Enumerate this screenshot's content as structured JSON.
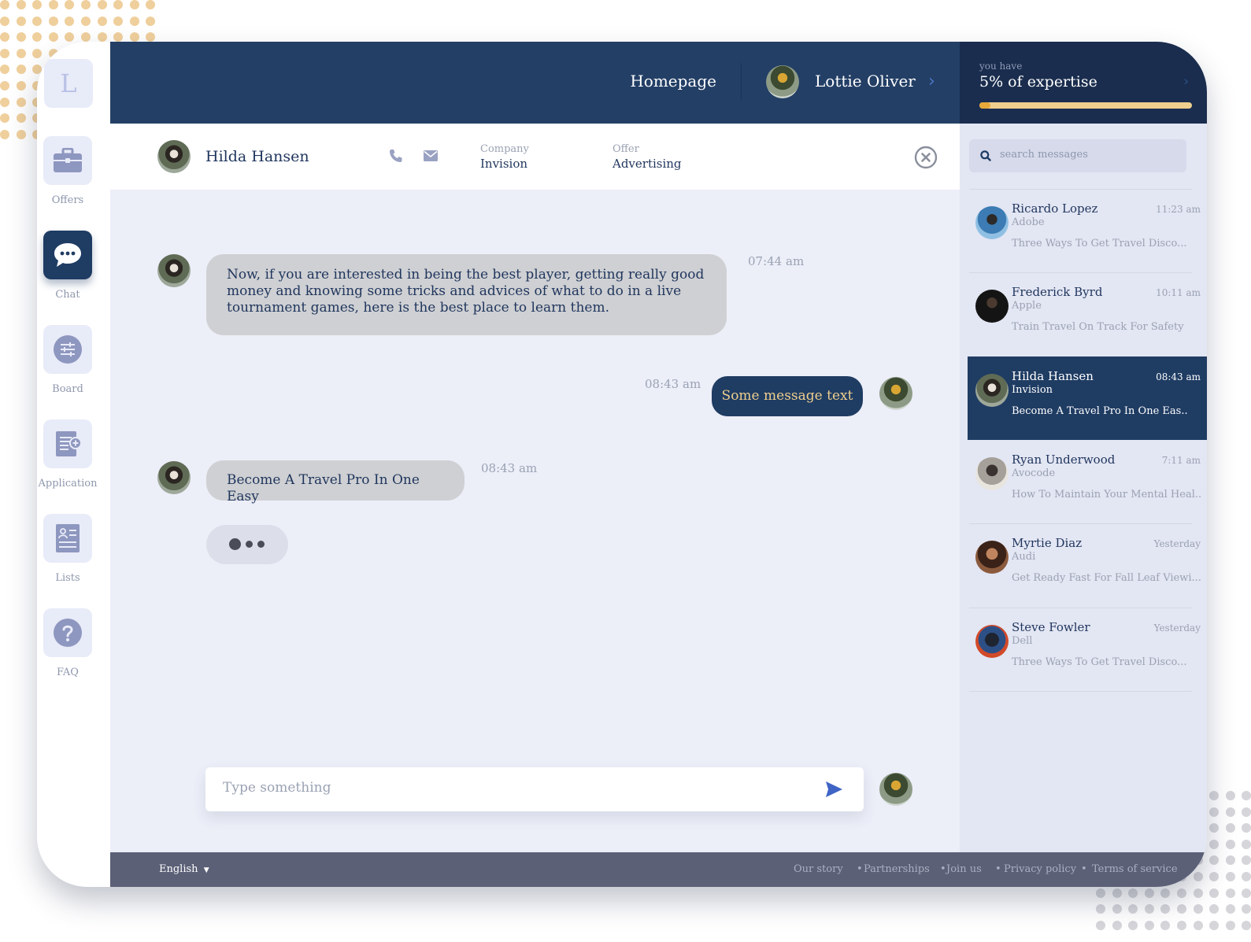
{
  "app": {
    "logo_letter": "L"
  },
  "sidebar": {
    "items": [
      {
        "label": "Offers",
        "icon": "briefcase-icon"
      },
      {
        "label": "Chat",
        "icon": "chat-bubble-icon",
        "active": true
      },
      {
        "label": "Board",
        "icon": "sliders-icon"
      },
      {
        "label": "Application",
        "icon": "document-add-icon"
      },
      {
        "label": "Lists",
        "icon": "id-card-icon"
      },
      {
        "label": "FAQ",
        "icon": "question-icon"
      }
    ]
  },
  "header": {
    "homepage_label": "Homepage",
    "user_name": "Lottie Oliver",
    "expertise_caption": "you have",
    "expertise_text": "5% of expertise",
    "expertise_progress": 0.05
  },
  "conversation": {
    "contact_name": "Hilda Hansen",
    "company_label": "Company",
    "company_value": "Invision",
    "offer_label": "Offer",
    "offer_value": "Advertising"
  },
  "messages": [
    {
      "direction": "in",
      "text": "Now, if you are interested in being the best player, getting really good money and knowing some tricks and advices of what to do in a live tournament games, here is the best place to learn them.",
      "time": "07:44 am"
    },
    {
      "direction": "out",
      "text": "Some message text",
      "time": "08:43 am"
    },
    {
      "direction": "in",
      "text": "Become A Travel Pro In One Easy",
      "time": "08:43 am"
    }
  ],
  "composer": {
    "placeholder": "Type something"
  },
  "search": {
    "placeholder": "search messages"
  },
  "threads": [
    {
      "name": "Ricardo Lopez",
      "company": "Adobe",
      "time": "11:23 am",
      "preview": "Three Ways To Get Travel Disco..."
    },
    {
      "name": "Frederick Byrd",
      "company": "Apple",
      "time": "10:11 am",
      "preview": "Train Travel On Track For Safety"
    },
    {
      "name": "Hilda Hansen",
      "company": "Invision",
      "time": "08:43 am",
      "preview": "Become A Travel Pro In One Eas..",
      "active": true
    },
    {
      "name": "Ryan Underwood",
      "company": "Avocode",
      "time": "7:11 am",
      "preview": "How To Maintain Your Mental Heal.."
    },
    {
      "name": "Myrtie Diaz",
      "company": "Audi",
      "time": "Yesterday",
      "preview": "Get Ready Fast For Fall Leaf Viewi..."
    },
    {
      "name": "Steve Fowler",
      "company": "Dell",
      "time": "Yesterday",
      "preview": "Three Ways To Get Travel Disco..."
    }
  ],
  "footer": {
    "language": "English",
    "links": [
      "Our story",
      "Partnerships",
      "Join us",
      "Privacy policy",
      "Terms of service"
    ]
  },
  "colors": {
    "primary": "#233f66",
    "accent_gold": "#efcf8e",
    "panel_bg": "#e3e6f3",
    "chat_bg": "#eceef8"
  }
}
